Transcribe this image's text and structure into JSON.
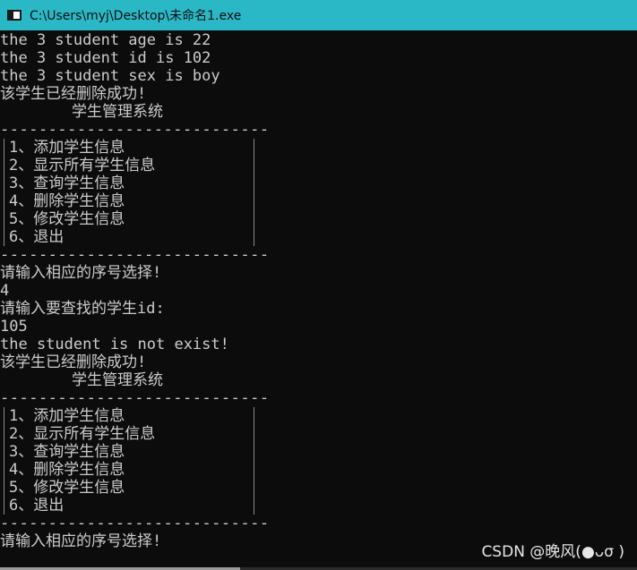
{
  "window": {
    "title": "C:\\Users\\myj\\Desktop\\未命名1.exe",
    "icon": "console-window-icon",
    "accent_color": "#2bb8c6",
    "background_color": "#0c0c0c",
    "text_color": "#cccccc"
  },
  "output": {
    "age_line": "the 3 student age is 22",
    "id_line": "the 3 student id is 102",
    "sex_line": "the 3 student sex is boy",
    "delete_success_1": "该学生已经删除成功!",
    "prompt_select_1": "请输入相应的序号选择!",
    "input_choice": "4",
    "prompt_search_id": "请输入要查找的学生id:",
    "input_id": "105",
    "not_exist": "the student is not exist!",
    "delete_success_2": "该学生已经删除成功!",
    "prompt_select_2": "请输入相应的序号选择!"
  },
  "menu": {
    "title": "学生管理系统",
    "separator": "----------------------------",
    "items": [
      "1、添加学生信息",
      "2、显示所有学生信息",
      "3、查询学生信息",
      "4、删除学生信息",
      "5、修改学生信息",
      "6、退出"
    ]
  },
  "watermark": "CSDN @晚风(●ᴗσ )"
}
